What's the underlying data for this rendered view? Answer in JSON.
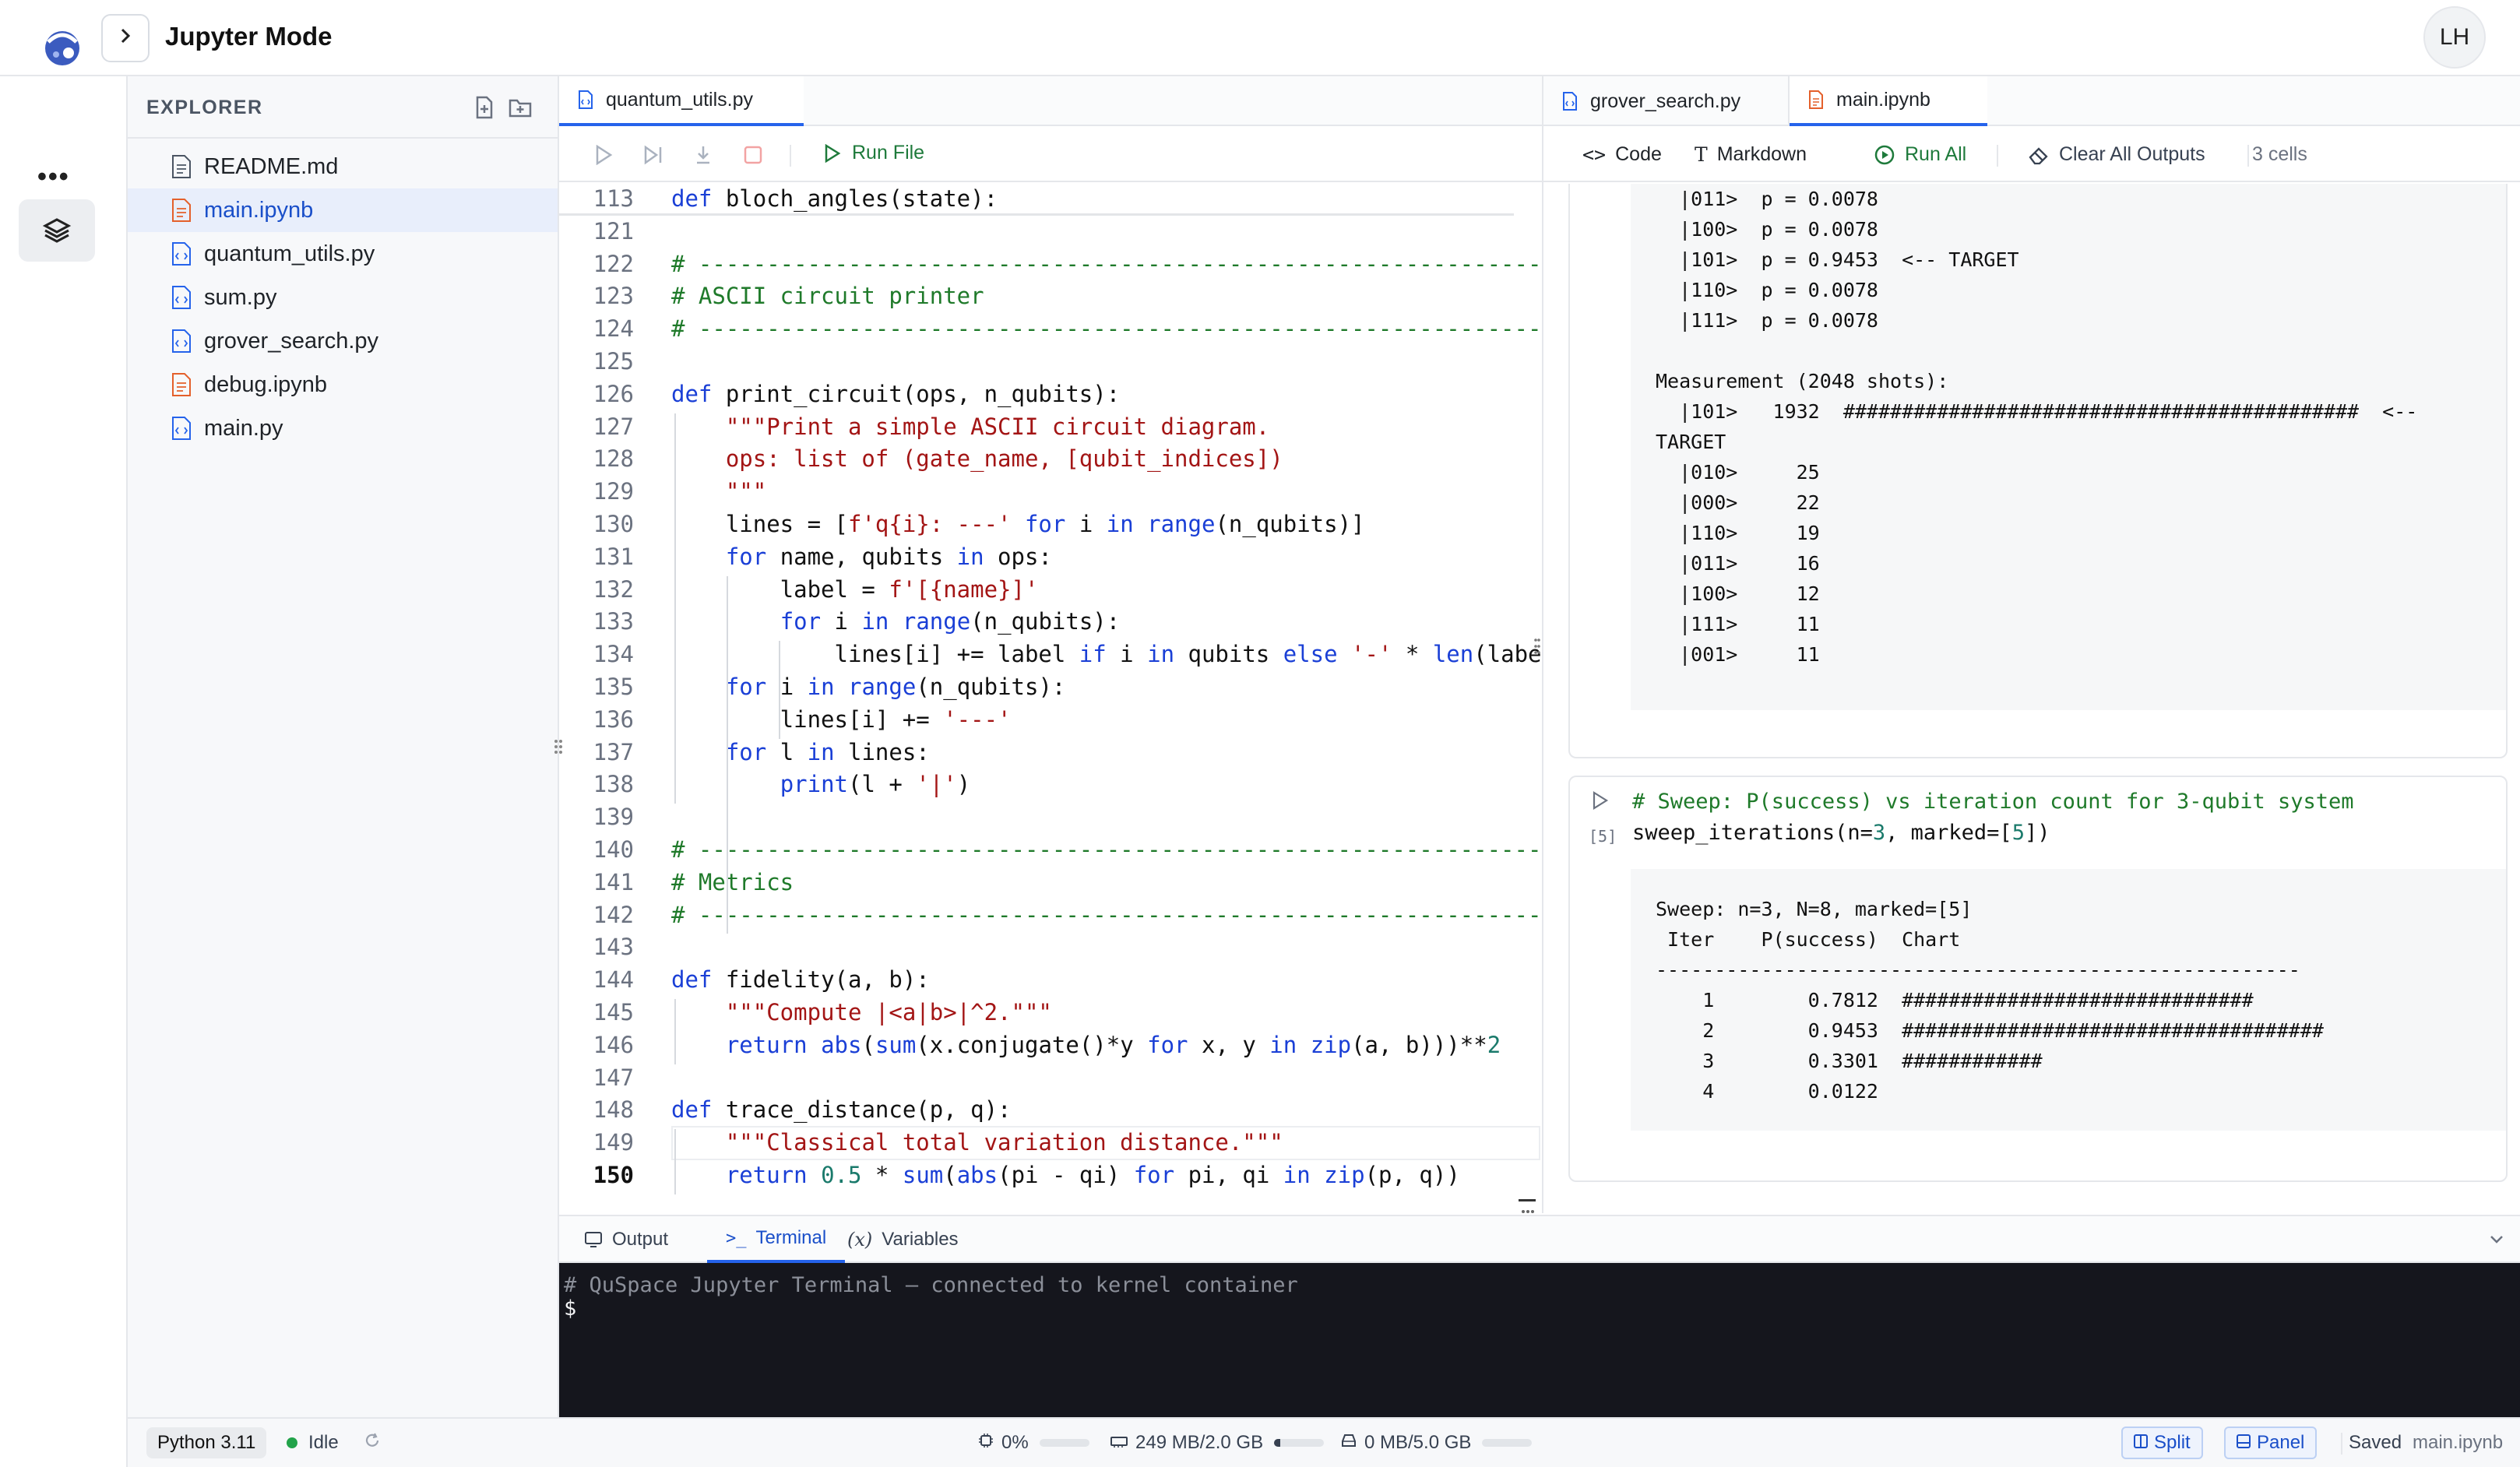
{
  "app": {
    "title": "Jupyter Mode",
    "avatar_initials": "LH",
    "more_label": "•••"
  },
  "explorer": {
    "title": "EXPLORER",
    "files": [
      {
        "name": "README.md",
        "type": "md",
        "active": false
      },
      {
        "name": "main.ipynb",
        "type": "ipynb",
        "active": true
      },
      {
        "name": "quantum_utils.py",
        "type": "py",
        "active": false
      },
      {
        "name": "sum.py",
        "type": "py",
        "active": false
      },
      {
        "name": "grover_search.py",
        "type": "py",
        "active": false
      },
      {
        "name": "debug.ipynb",
        "type": "ipynb",
        "active": false
      },
      {
        "name": "main.py",
        "type": "py",
        "active": false
      }
    ]
  },
  "editor": {
    "tab": "quantum_utils.py",
    "run_file_label": "Run File",
    "lines": [
      {
        "n": "113",
        "html": "<span class='kw'>def</span> bloch_angles(state):"
      },
      {
        "n": "121",
        "html": ""
      },
      {
        "n": "122",
        "html": "<span class='cm'># -------------------------------------------------------------------</span>"
      },
      {
        "n": "123",
        "html": "<span class='cm'># ASCII circuit printer</span>"
      },
      {
        "n": "124",
        "html": "<span class='cm'># -------------------------------------------------------------------</span>"
      },
      {
        "n": "125",
        "html": ""
      },
      {
        "n": "126",
        "html": "<span class='kw'>def</span> print_circuit(ops, n_qubits):"
      },
      {
        "n": "127",
        "html": "    <span class='st'>\"\"\"Print a simple ASCII circuit diagram.</span>"
      },
      {
        "n": "128",
        "html": "<span class='st'>    ops: list of (gate_name, [qubit_indices])</span>"
      },
      {
        "n": "129",
        "html": "<span class='st'>    \"\"\"</span>"
      },
      {
        "n": "130",
        "html": "    lines = [<span class='st'>f'q{i}: ---'</span> <span class='kw'>for</span> i <span class='kw'>in</span> <span class='kw'>range</span>(n_qubits)]"
      },
      {
        "n": "131",
        "html": "    <span class='kw'>for</span> name, qubits <span class='kw'>in</span> ops:"
      },
      {
        "n": "132",
        "html": "        label = <span class='st'>f'[{name}]'</span>"
      },
      {
        "n": "133",
        "html": "        <span class='kw'>for</span> i <span class='kw'>in</span> <span class='kw'>range</span>(n_qubits):"
      },
      {
        "n": "134",
        "html": "            lines[i] += label <span class='kw'>if</span> i <span class='kw'>in</span> qubits <span class='kw'>else</span> <span class='st'>'-'</span> * <span class='kw'>len</span>(label)"
      },
      {
        "n": "135",
        "html": "    <span class='kw'>for</span> i <span class='kw'>in</span> <span class='kw'>range</span>(n_qubits):"
      },
      {
        "n": "136",
        "html": "        lines[i] += <span class='st'>'---'</span>"
      },
      {
        "n": "137",
        "html": "    <span class='kw'>for</span> l <span class='kw'>in</span> lines:"
      },
      {
        "n": "138",
        "html": "        <span class='kw'>print</span>(l + <span class='st'>'|'</span>)"
      },
      {
        "n": "139",
        "html": ""
      },
      {
        "n": "140",
        "html": "<span class='cm'># -------------------------------------------------------------------</span>"
      },
      {
        "n": "141",
        "html": "<span class='cm'># Metrics</span>"
      },
      {
        "n": "142",
        "html": "<span class='cm'># -------------------------------------------------------------------</span>"
      },
      {
        "n": "143",
        "html": ""
      },
      {
        "n": "144",
        "html": "<span class='kw'>def</span> fidelity(a, b):"
      },
      {
        "n": "145",
        "html": "    <span class='st'>\"\"\"Compute |&lt;a|b&gt;|^2.\"\"\"</span>"
      },
      {
        "n": "146",
        "html": "    <span class='kw'>return</span> <span class='kw'>abs</span>(<span class='kw'>sum</span>(x.conjugate()*y <span class='kw'>for</span> x, y <span class='kw'>in</span> <span class='kw'>zip</span>(a, b)))**<span class='nb'>2</span>"
      },
      {
        "n": "147",
        "html": ""
      },
      {
        "n": "148",
        "html": "<span class='kw'>def</span> trace_distance(p, q):"
      },
      {
        "n": "149",
        "html": "    <span class='st'>\"\"\"Classical total variation distance.\"\"\"</span>"
      },
      {
        "n": "150",
        "html": "    <span class='kw'>return</span> <span class='nb'>0.5</span> * <span class='kw'>sum</span>(<span class='kw'>abs</span>(pi - qi) <span class='kw'>for</span> pi, qi <span class='kw'>in</span> <span class='kw'>zip</span>(p, q))"
      }
    ]
  },
  "notebook": {
    "tabs": [
      "grover_search.py",
      "main.ipynb"
    ],
    "toolbar": {
      "code": "Code",
      "markdown": "Markdown",
      "run_all": "Run All",
      "clear": "Clear All Outputs",
      "cells": "3 cells"
    },
    "output1": "  |011>  p = 0.0078\n  |100>  p = 0.0078\n  |101>  p = 0.9453  <-- TARGET\n  |110>  p = 0.0078\n  |111>  p = 0.0078\n\nMeasurement (2048 shots):\n  |101>   1932  ############################################  <--\nTARGET\n  |010>     25\n  |000>     22\n  |110>     19\n  |011>     16\n  |100>     12\n  |111>     11\n  |001>     11",
    "cell2": {
      "exec": "[5]",
      "comment": "# Sweep: P(success) vs iteration count for 3-qubit system",
      "call_html": "sweep_iterations(n=<span class='nb'>3</span>, marked=[<span class='nb'>5</span>])"
    },
    "output2": "Sweep: n=3, N=8, marked=[5]\n Iter    P(success)  Chart\n-------------------------------------------------------\n    1        0.7812  ##############################\n    2        0.9453  ####################################\n    3        0.3301  ############\n    4        0.0122"
  },
  "bottom": {
    "tabs": [
      "Output",
      "Terminal",
      "Variables"
    ],
    "active_tab": "Terminal",
    "terminal_line1": "# QuSpace Jupyter Terminal — connected to kernel container",
    "terminal_prompt": "$"
  },
  "status": {
    "python": "Python 3.11",
    "kernel_state": "Idle",
    "cpu": "0%",
    "cpu_fraction": 0.0,
    "mem": "249 MB/2.0 GB",
    "mem_fraction": 0.12,
    "disk": "0 MB/5.0 GB",
    "disk_fraction": 0.0,
    "split": "Split",
    "panel": "Panel",
    "saved": "Saved",
    "file": "main.ipynb"
  },
  "colors": {
    "accent": "#2563eb",
    "keyword": "#1a3fd6",
    "comment": "#1f7a2a",
    "string": "#a31515",
    "run_green": "#1e7a3b",
    "idle_dot": "#22a34a",
    "ipynb_orange": "#e4602b"
  }
}
